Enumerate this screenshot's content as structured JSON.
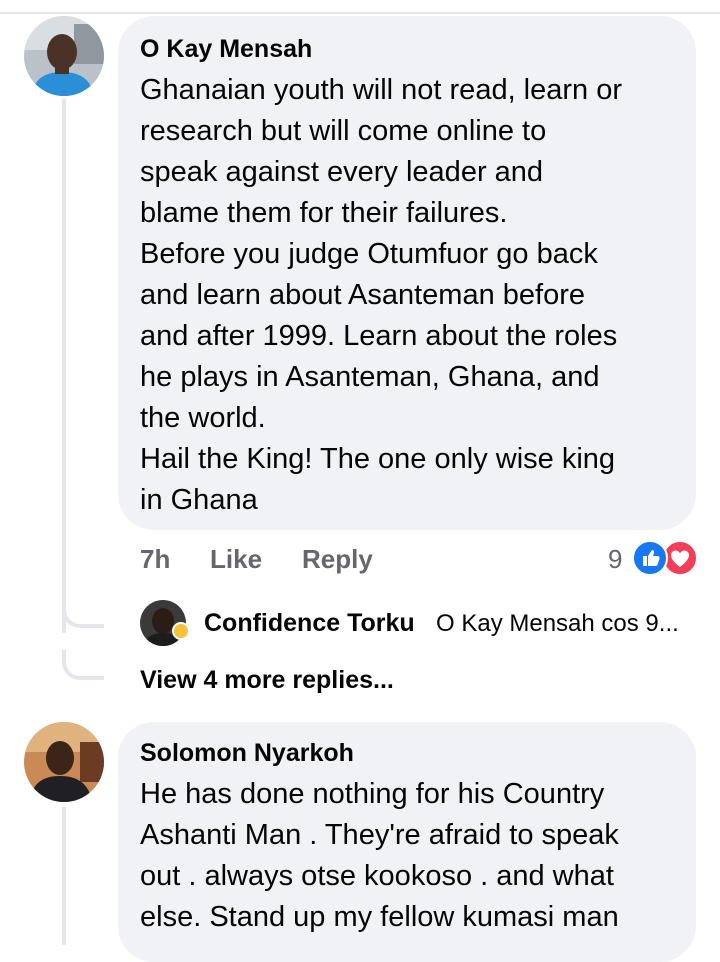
{
  "comments": [
    {
      "author": "O Kay Mensah",
      "text": "Ghanaian youth will not read, learn or\nresearch but will come online to\nspeak against every leader and\nblame them for their failures.\nBefore you judge Otumfuor go back\nand learn about Asanteman before\nand after 1999. Learn about the roles\nhe plays in Asanteman, Ghana, and\nthe world.\nHail the King! The one only wise king\nin Ghana",
      "time": "7h",
      "like_label": "Like",
      "reply_label": "Reply",
      "reaction_count": "9",
      "reactions": [
        "like-icon",
        "love-icon"
      ],
      "reply_preview": {
        "author": "Confidence Torku",
        "snippet": "O Kay Mensah cos 9..."
      },
      "view_more_label": "View 4 more replies..."
    },
    {
      "author": "Solomon Nyarkoh",
      "text": "He has done nothing for his Country\nAshanti Man . They're afraid to speak\nout . always otse kookoso . and what\nelse. Stand up my fellow kumasi man"
    }
  ],
  "colors": {
    "bubble_bg": "#f0f2f5",
    "secondary_text": "#65676b",
    "like_blue": "#1877f2",
    "love_red": "#f33e58",
    "thread_line": "#e4e6eb"
  }
}
